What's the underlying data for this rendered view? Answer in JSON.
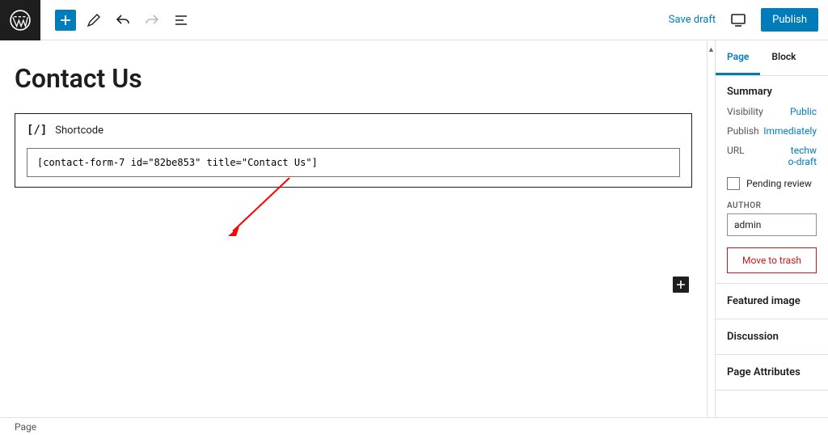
{
  "topbar": {
    "save_draft_label": "Save draft",
    "publish_label": "Publish"
  },
  "editor": {
    "page_title": "Contact Us",
    "shortcode": {
      "label": "Shortcode",
      "icon_text": "[/]",
      "value": "[contact-form-7 id=\"82be853\" title=\"Contact Us\"]"
    }
  },
  "sidebar": {
    "tabs": {
      "page": "Page",
      "block": "Block"
    },
    "summary": {
      "title": "Summary",
      "visibility_label": "Visibility",
      "visibility_value": "Public",
      "publish_label": "Publish",
      "publish_value": "Immediately",
      "url_label": "URL",
      "url_value_line1": "techw",
      "url_value_line2": "o-draft",
      "pending_label": "Pending review",
      "author_heading": "AUTHOR",
      "author_value": "admin",
      "trash_label": "Move to trash"
    },
    "panels": {
      "featured_image": "Featured image",
      "discussion": "Discussion",
      "page_attributes": "Page Attributes"
    }
  },
  "breadcrumb": "Page"
}
